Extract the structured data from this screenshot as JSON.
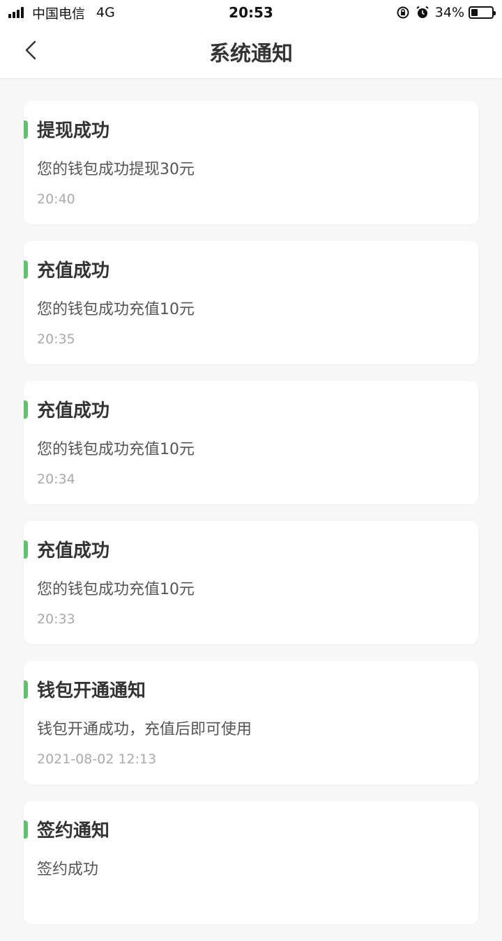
{
  "statusbar": {
    "carrier": "中国电信",
    "network": "4G",
    "time": "20:53",
    "battery_percent": "34%",
    "icons": [
      "signal-icon",
      "rotation-lock-icon",
      "alarm-icon",
      "battery-icon"
    ]
  },
  "navbar": {
    "title": "系统通知",
    "back_icon": "chevron-left-icon"
  },
  "colors": {
    "accent": "#5cc46a",
    "background": "#f7f7f7",
    "card": "#ffffff"
  },
  "notifications": [
    {
      "title": "提现成功",
      "desc": "您的钱包成功提现30元",
      "time": "20:40"
    },
    {
      "title": "充值成功",
      "desc": "您的钱包成功充值10元",
      "time": "20:35"
    },
    {
      "title": "充值成功",
      "desc": "您的钱包成功充值10元",
      "time": "20:34"
    },
    {
      "title": "充值成功",
      "desc": "您的钱包成功充值10元",
      "time": "20:33"
    },
    {
      "title": "钱包开通通知",
      "desc": "钱包开通成功，充值后即可使用",
      "time": "2021-08-02 12:13"
    },
    {
      "title": "签约通知",
      "desc": "签约成功",
      "time": ""
    }
  ]
}
